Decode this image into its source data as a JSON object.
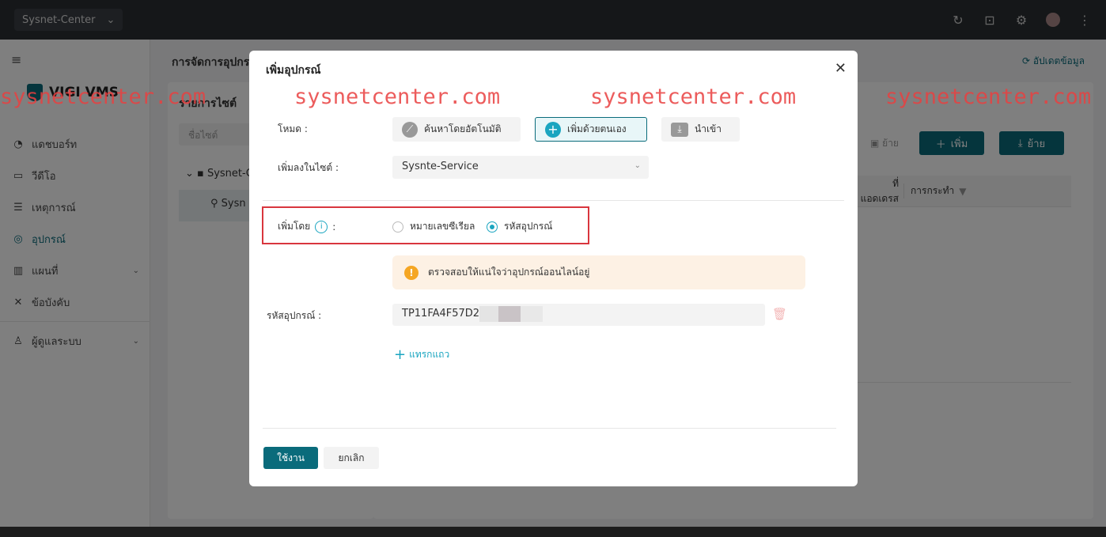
{
  "topbar": {
    "site_selector": "Sysnet-Center",
    "site_chevron": "⌄"
  },
  "sidebar": {
    "menu_icon": "≡",
    "logo_text": "VIGI VMS",
    "items": [
      {
        "label": "แดชบอร์ท",
        "icon": "gauge-icon"
      },
      {
        "label": "วีดีโอ",
        "icon": "video-icon"
      },
      {
        "label": "เหตุการณ์",
        "icon": "document-icon"
      },
      {
        "label": "อุปกรณ์",
        "icon": "device-icon",
        "active": true
      },
      {
        "label": "แผนที่",
        "icon": "map-icon"
      },
      {
        "label": "ข้อบังคับ",
        "icon": "rules-icon"
      },
      {
        "label": "ผู้ดูแลระบบ",
        "icon": "user-icon"
      }
    ]
  },
  "main": {
    "page_title": "การจัดการอุปกร",
    "update_link": "อัปเดตข้อมูล",
    "site_panel_title": "รายการไซต์",
    "site_search_placeholder": "ชื่อไซต์",
    "tree_root": "Sysnet-C",
    "tree_child": "Sysn",
    "move_link": "ย้าย",
    "add_button": "เพิ่ม",
    "move_button": "ย้าย",
    "col_address": "ที่ แอดเดรส",
    "col_action": "การกระทำ"
  },
  "dialog": {
    "title": "เพิ่มอุปกรณ์",
    "mode_label": "โหมด :",
    "modes": [
      "ค้นหาโดยอัตโนมัติ",
      "เพิ่มด้วยตนเอง",
      "นำเข้า"
    ],
    "site_label": "เพิ่มลงในไซต์ :",
    "site_value": "Sysnte-Service",
    "add_by_label": "เพิ่มโดย",
    "add_by_colon": ":",
    "radio_serial": "หมายเลขซีเรียล",
    "radio_code": "รหัสอุปกรณ์",
    "warning": "ตรวจสอบให้แน่ใจว่าอุปกรณ์ออนไลน์อยู่",
    "code_label": "รหัสอุปกรณ์ :",
    "code_value": "TP11FA4F57D21",
    "add_row": "แทรกแถว",
    "ok": "ใช้งาน",
    "cancel": "ยกเลิก"
  },
  "watermark": "sysnetcenter.com",
  "colors": {
    "accent": "#0a6b7b",
    "link": "#1aa5c0",
    "highlight_box": "#d9363e",
    "watermark": "#e94040"
  }
}
